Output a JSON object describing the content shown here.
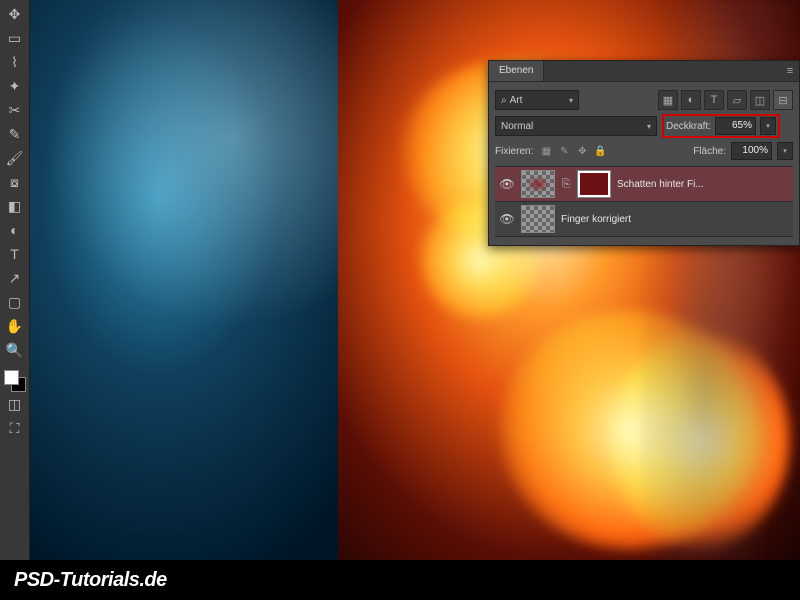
{
  "watermark": "PSD-Tutorials.de",
  "toolbar": {
    "tools": [
      "move",
      "marquee",
      "lasso",
      "wand",
      "crop",
      "eyedropper",
      "healing",
      "brush",
      "stamp",
      "eraser",
      "gradient",
      "blur",
      "pen",
      "type",
      "path",
      "shape",
      "hand",
      "zoom"
    ]
  },
  "panel": {
    "title": "Ebenen",
    "filter_label": "Art",
    "blend_mode": "Normal",
    "opacity_label": "Deckkraft:",
    "opacity_value": "65%",
    "lock_label": "Fixieren:",
    "fill_label": "Fläche:",
    "fill_value": "100%",
    "layers": [
      {
        "name": "Schatten hinter Fi...",
        "visible": true,
        "selected": true,
        "has_mask": true
      },
      {
        "name": "Finger korrigiert",
        "visible": true,
        "selected": false,
        "has_mask": false
      }
    ]
  }
}
